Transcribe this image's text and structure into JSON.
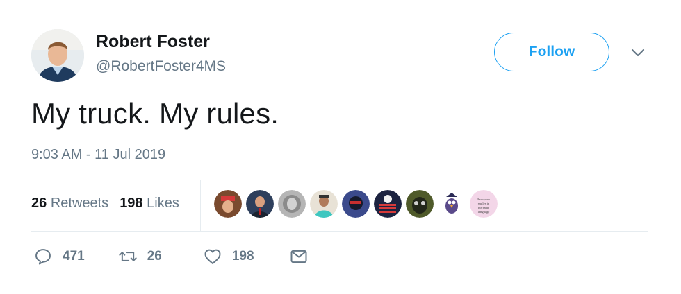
{
  "user": {
    "name": "Robert Foster",
    "handle": "@RobertFoster4MS"
  },
  "follow_label": "Follow",
  "tweet": {
    "text": "My truck. My rules.",
    "timestamp": "9:03 AM - 11 Jul 2019"
  },
  "stats": {
    "retweets_count": "26",
    "retweets_label": "Retweets",
    "likes_count": "198",
    "likes_label": "Likes"
  },
  "likers": [
    {
      "name": "liker-avatar-1",
      "color": "#7a4a2e"
    },
    {
      "name": "liker-avatar-2",
      "color": "#2e3f5c"
    },
    {
      "name": "liker-avatar-3",
      "color": "#9a9a9a"
    },
    {
      "name": "liker-avatar-4",
      "color": "#3fc7c0"
    },
    {
      "name": "liker-avatar-5",
      "color": "#3b4a8c"
    },
    {
      "name": "liker-avatar-6",
      "color": "#1c2340"
    },
    {
      "name": "liker-avatar-7",
      "color": "#4f5a2a"
    },
    {
      "name": "liker-avatar-8",
      "color": "#ffffff"
    },
    {
      "name": "liker-avatar-9",
      "color": "#f3d6e8"
    }
  ],
  "liker_9_text": "Everyone smiles in the same language",
  "actions": {
    "reply_count": "471",
    "retweet_count": "26",
    "like_count": "198"
  },
  "colors": {
    "accent": "#1da1f2",
    "secondary_text": "#657786",
    "primary_text": "#14171a"
  }
}
